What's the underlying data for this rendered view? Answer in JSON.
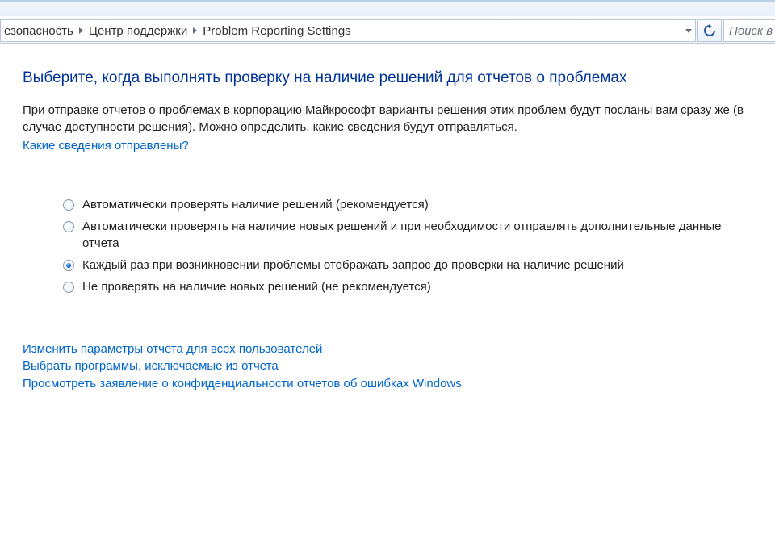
{
  "breadcrumb": {
    "items": [
      "езопасность",
      "Центр поддержки",
      "Problem Reporting Settings"
    ]
  },
  "search": {
    "placeholder": "Поиск в"
  },
  "heading": "Выберите, когда выполнять проверку на наличие решений для отчетов о проблемах",
  "description": "При отправке отчетов о проблемах в корпорацию Майкрософт варианты решения этих проблем будут посланы вам сразу же (в случае доступности решения). Можно определить, какие сведения будут отправляться.",
  "info_link": "Какие сведения отправлены?",
  "options": [
    {
      "label": "Автоматически проверять наличие решений (рекомендуется)",
      "selected": false
    },
    {
      "label": "Автоматически проверять на наличие новых решений и при необходимости отправлять дополнительные данные отчета",
      "selected": false
    },
    {
      "label": "Каждый раз при возникновении проблемы отображать запрос до проверки на наличие решений",
      "selected": true
    },
    {
      "label": "Не проверять на наличие новых решений (не рекомендуется)",
      "selected": false
    }
  ],
  "bottom_links": [
    "Изменить параметры отчета для всех пользователей",
    "Выбрать программы, исключаемые из отчета",
    "Просмотреть заявление о конфиденциальности отчетов об ошибках Windows"
  ]
}
